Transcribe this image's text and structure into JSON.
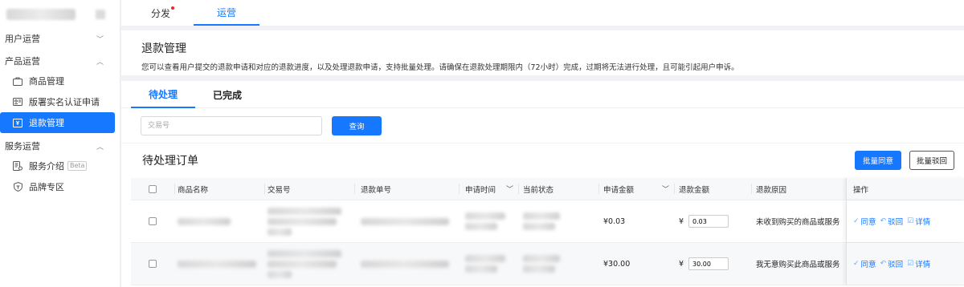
{
  "sidebar": {
    "groups": [
      {
        "label": "用户运营",
        "expanded": false
      },
      {
        "label": "产品运营",
        "expanded": true
      },
      {
        "label": "服务运营",
        "expanded": true
      }
    ],
    "items": [
      {
        "label": "商品管理",
        "icon": "briefcase-icon"
      },
      {
        "label": "版署实名认证申请",
        "icon": "id-card-icon"
      },
      {
        "label": "退款管理",
        "icon": "refund-icon",
        "active": true
      },
      {
        "label": "服务介绍",
        "icon": "service-doc-icon",
        "badge": "Beta"
      },
      {
        "label": "品牌专区",
        "icon": "shield-icon"
      }
    ]
  },
  "top_tabs": [
    {
      "label": "分发",
      "dot": true
    },
    {
      "label": "运营",
      "active": true
    }
  ],
  "header": {
    "title": "退款管理",
    "description": "您可以查看用户提交的退款申请和对应的退款进度，以及处理退款申请，支持批量处理。请确保在退款处理期限内（72小时）完成，过期将无法进行处理，且可能引起用户申诉。"
  },
  "sub_tabs": [
    {
      "label": "待处理",
      "active": true
    },
    {
      "label": "已完成"
    }
  ],
  "search": {
    "placeholder": "交易号",
    "button_label": "查询"
  },
  "list": {
    "title": "待处理订单",
    "batch_approve_label": "批量同意",
    "batch_reject_label": "批量驳回"
  },
  "table": {
    "columns": [
      "商品名称",
      "交易号",
      "退款单号",
      "申请时间",
      "当前状态",
      "申请金额",
      "退款金额",
      "退款原因",
      "操作"
    ],
    "rows": [
      {
        "apply_amount": "¥0.03",
        "currency": "¥",
        "refund_amount": "0.03",
        "reason": "未收到购买的商品或服务"
      },
      {
        "apply_amount": "¥30.00",
        "currency": "¥",
        "refund_amount": "30.00",
        "reason": "我无意购买此商品或服务"
      }
    ],
    "actions": {
      "approve": "同意",
      "reject": "驳回",
      "detail": "详情"
    }
  },
  "colors": {
    "accent": "#1677ff",
    "dot": "#f5222d"
  }
}
